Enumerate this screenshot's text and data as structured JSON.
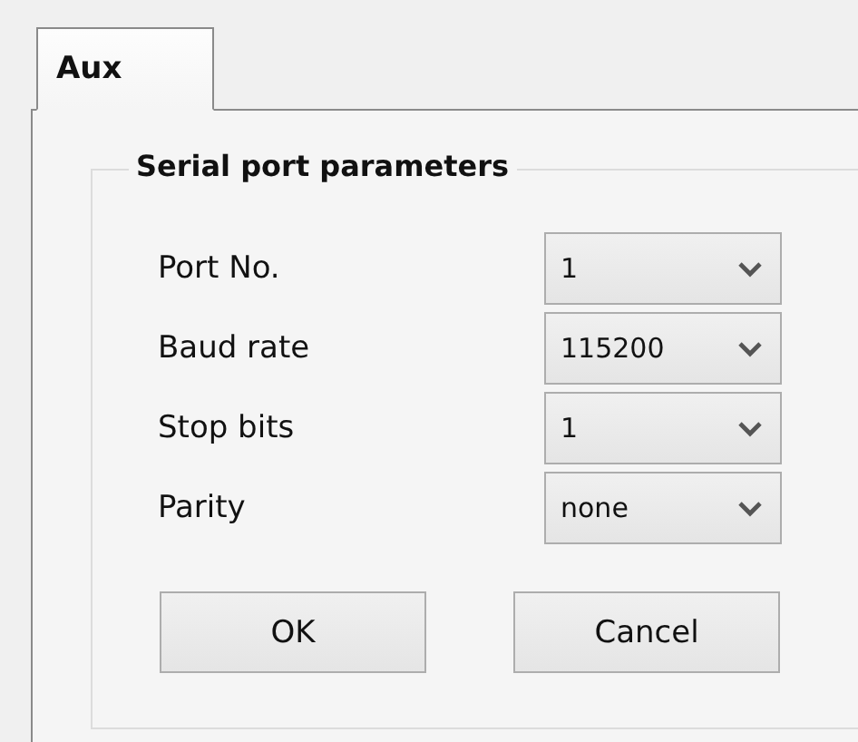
{
  "tabs": [
    {
      "label": "Aux",
      "selected": true
    }
  ],
  "group": {
    "title": "Serial port parameters",
    "fields": [
      {
        "label": "Port No.",
        "value": "1"
      },
      {
        "label": "Baud rate",
        "value": "115200"
      },
      {
        "label": "Stop bits",
        "value": "1"
      },
      {
        "label": "Parity",
        "value": "none"
      }
    ]
  },
  "buttons": [
    "OK",
    "Cancel"
  ]
}
